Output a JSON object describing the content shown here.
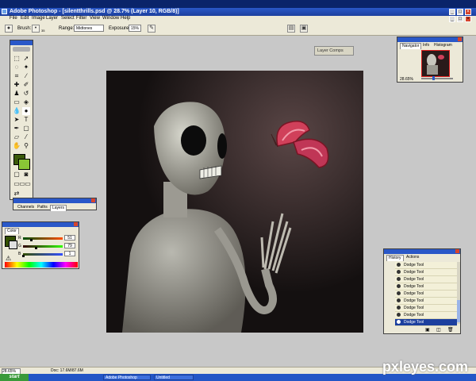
{
  "window": {
    "app_title": "Adobe Photoshop",
    "doc_title": "Adobe Photoshop - [silentthrills.psd @ 28.7% (Layer 10, RGB/8)]",
    "controls": [
      "_",
      "□",
      "×"
    ]
  },
  "menu": [
    "File",
    "Edit",
    "Image",
    "Layer",
    "Select",
    "Filter",
    "View",
    "Window",
    "Help"
  ],
  "options_bar": {
    "brush_label": "Brush:",
    "brush_size": "35",
    "range_label": "Range:",
    "range_value": "Midtones",
    "exposure_label": "Exposure:",
    "exposure_value": "15%",
    "palette_well_label": "Layer Comps"
  },
  "panels": {
    "navigator": {
      "tabs": [
        "Navigator",
        "Info",
        "Histogram"
      ],
      "zoom": "28.65%"
    },
    "layers_group": {
      "tabs": [
        "Channels",
        "Paths",
        "Layers"
      ]
    },
    "color": {
      "tab": "Color",
      "channels": [
        {
          "label": "R",
          "value": "51",
          "level": 0.2
        },
        {
          "label": "G",
          "value": "79",
          "level": 0.31
        },
        {
          "label": "B",
          "value": "1",
          "level": 0.0
        }
      ],
      "fg_color": "#334f01"
    },
    "history": {
      "tabs": [
        "History",
        "Actions"
      ],
      "items": [
        "Dodge Tool",
        "Dodge Tool",
        "Dodge Tool",
        "Dodge Tool",
        "Dodge Tool",
        "Dodge Tool",
        "Dodge Tool",
        "Dodge Tool",
        "Dodge Tool"
      ],
      "selected_index": 8
    }
  },
  "status_bar": {
    "zoom": "28.65%",
    "doc_size": "Doc: 17.6M/87.6M"
  },
  "taskbar": {
    "start_label": "start",
    "items": [
      "Adobe Photoshop",
      "Untitled"
    ]
  },
  "watermark": "pxleyes.com",
  "colors": {
    "title_blue": "#2a58c8",
    "ui_gray": "#ece9d8",
    "workspace": "#c8c8c8",
    "fg_swatch": "#3b5a0a",
    "bg_swatch": "#8ac636",
    "butterfly": "#d0405a"
  }
}
